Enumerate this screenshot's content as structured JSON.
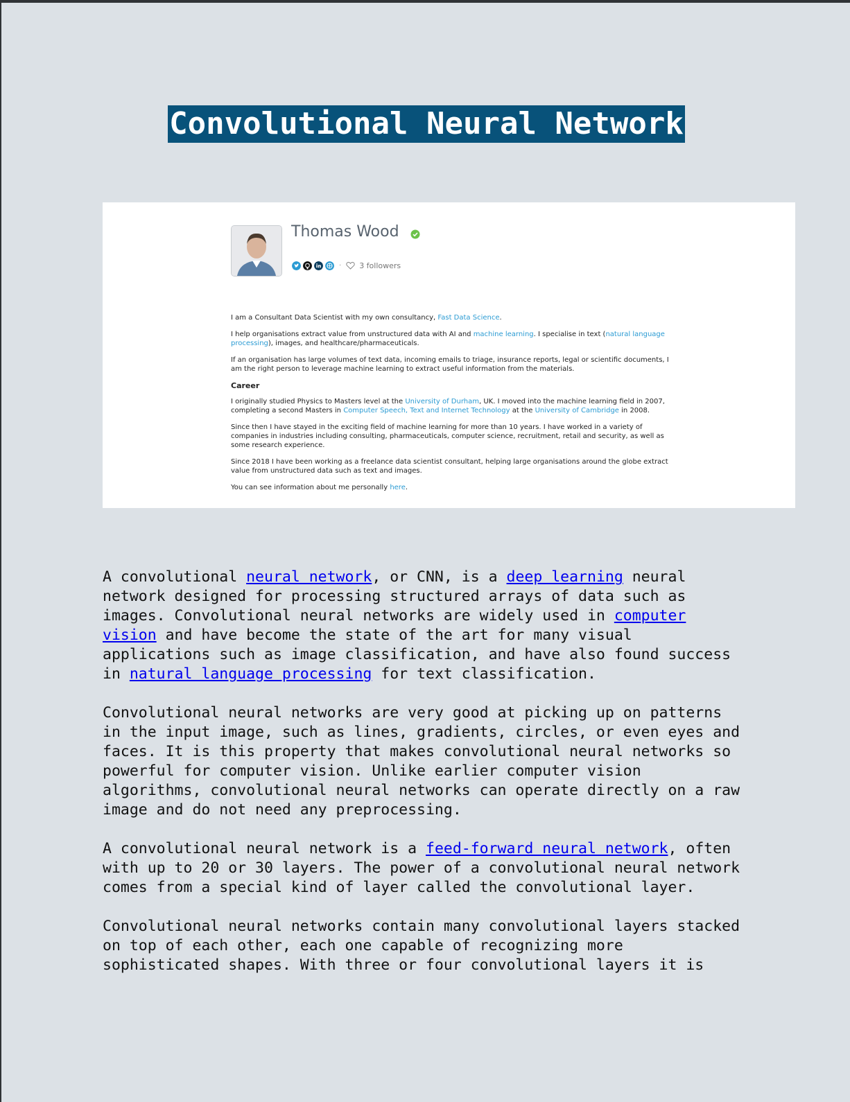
{
  "page": {
    "title": "Convolutional Neural Network"
  },
  "profile": {
    "name": "Thomas Wood",
    "followers": "3 followers",
    "social_icons": [
      "twitter-icon",
      "github-icon",
      "linkedin-icon",
      "website-icon"
    ],
    "bio": {
      "p1": {
        "t1": "I am a Consultant Data Scientist with my own consultancy, ",
        "l1": "Fast Data Science",
        "t2": "."
      },
      "p2": {
        "t1": "I help organisations extract value from unstructured data with AI and ",
        "l1": "machine learning",
        "t2": ". I specialise in text (",
        "l2": "natural language processing",
        "t3": "), images, and healthcare/pharmaceuticals."
      },
      "p3": "If an organisation has large volumes of text data, incoming emails to triage, insurance reports, legal or scientific documents, I am the right person to leverage machine learning to extract useful information from the materials.",
      "career_heading": "Career",
      "p4": {
        "t1": "I originally studied Physics to Masters level at the ",
        "l1": "University of Durham",
        "t2": ", UK. I moved into the machine learning field in 2007, completing a second Masters in ",
        "l2": "Computer Speech, Text and Internet Technology",
        "t3": " at the ",
        "l3": "University of Cambridge",
        "t4": " in 2008."
      },
      "p5": "Since then I have stayed in the exciting field of machine learning for more than 10 years. I have worked in a variety of companies in industries including consulting, pharmaceuticals, computer science, recruitment, retail and security, as well as some research experience.",
      "p6": "Since 2018 I have been working as a freelance data scientist consultant, helping large organisations around the globe extract value from unstructured data such as text and images.",
      "p7": {
        "t1": "You can see information about me personally ",
        "l1": "here",
        "t2": "."
      }
    }
  },
  "article": {
    "p1": {
      "t1": "A convolutional ",
      "l1": "neural network",
      "t2": ", or CNN, is a ",
      "l2": "deep learning",
      "t3": " neural network designed for processing structured arrays of data such as images. Convolutional neural networks are widely used in ",
      "l3": "computer vision",
      "t4": " and have become the state of the art for many visual applications such as image classification, and have also found success in ",
      "l4": "natural language processing",
      "t5": " for text classification."
    },
    "p2": "Convolutional neural networks are very good at picking up on patterns in the input image, such as lines, gradients, circles, or even eyes and faces. It is this property that makes convolutional neural networks so powerful for computer vision. Unlike earlier computer vision algorithms, convolutional neural networks can operate directly on a raw image and do not need any preprocessing.",
    "p3": {
      "t1": "A convolutional neural network is a ",
      "l1": "feed-forward neural network",
      "t2": ", often with up to 20 or 30 layers. The power of a convolutional neural network comes from a special kind of layer called the convolutional layer."
    },
    "p4": "Convolutional neural networks contain many convolutional layers stacked on top of each other, each one capable of recognizing more sophisticated shapes. With three or four convolutional layers it is"
  },
  "colors": {
    "title_bg": "#08527a",
    "page_bg": "#dce1e6",
    "link": "#0000ee",
    "bio_link": "#2b9bd3",
    "verified": "#6cc24a"
  }
}
